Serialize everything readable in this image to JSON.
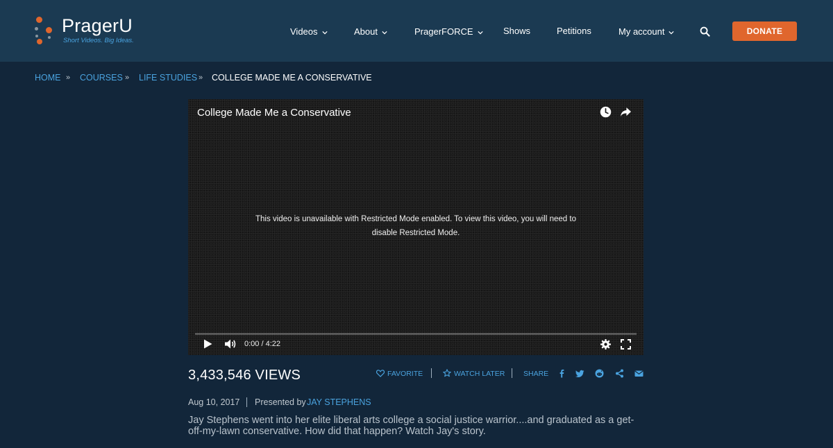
{
  "header": {
    "logo": {
      "name": "PragerU",
      "tagline": "Short Videos. Big Ideas."
    },
    "nav": [
      {
        "label": "Videos",
        "dropdown": true
      },
      {
        "label": "About",
        "dropdown": true
      },
      {
        "label": "PragerFORCE",
        "dropdown": true
      },
      {
        "label": "Shows",
        "dropdown": false
      },
      {
        "label": "Petitions",
        "dropdown": false
      },
      {
        "label": "My account",
        "dropdown": true
      }
    ],
    "search_icon": "search-icon",
    "donate_label": "DONATE"
  },
  "breadcrumb": {
    "items": [
      "HOME",
      "COURSES",
      "LIFE STUDIES"
    ],
    "current": "COLLEGE MADE ME A CONSERVATIVE"
  },
  "player": {
    "title": "College Made Me a Conservative",
    "message": "This video is unavailable with Restricted Mode enabled. To view this video, you will need to disable Restricted Mode.",
    "time": "0:00 / 4:22",
    "progress": 0,
    "icons": [
      "clock-icon",
      "share-arrow-icon",
      "play-icon",
      "volume-icon",
      "gear-icon",
      "fullscreen-icon"
    ]
  },
  "stats": {
    "views": "3,433,546 VIEWS",
    "favorite_label": "FAVORITE",
    "watch_later_label": "WATCH LATER",
    "share_label": "SHARE",
    "social_icons": [
      "facebook-icon",
      "twitter-icon",
      "reddit-icon",
      "share-icon",
      "email-icon"
    ]
  },
  "meta": {
    "date": "Aug 10, 2017",
    "presented_by": "Presented by",
    "author": "JAY STEPHENS"
  },
  "description": "Jay Stephens went into her elite liberal arts college a social justice warrior....and graduated as a get-off-my-lawn conservative. How did that happen? Watch Jay's story.",
  "colors": {
    "background": "#12263a",
    "header": "#1b3a52",
    "accent_orange": "#e0662d",
    "link_blue": "#4aa3df",
    "logo_dot_orange": "#e0662d",
    "logo_dot_gray": "#8a96a0"
  }
}
